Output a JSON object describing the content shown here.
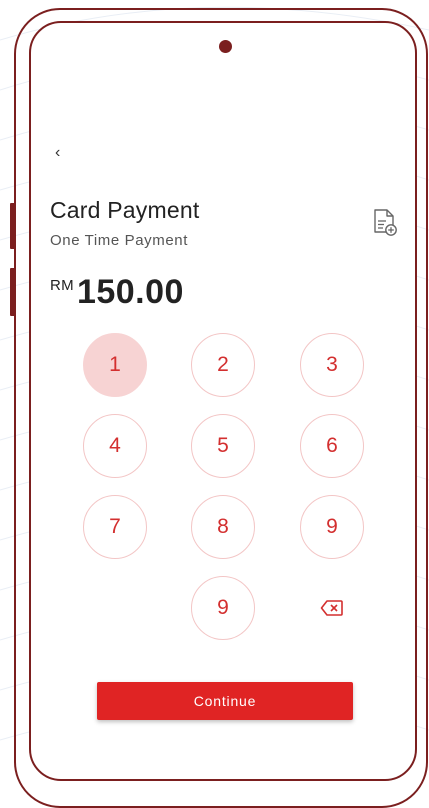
{
  "nav": {
    "back_symbol": "‹"
  },
  "header": {
    "title": "Card Payment",
    "subtitle": "One Time Payment",
    "action_icon": "receipt-add-icon"
  },
  "amount": {
    "currency": "RM",
    "value": "150.00"
  },
  "keypad": {
    "keys": [
      "1",
      "2",
      "3",
      "4",
      "5",
      "6",
      "7",
      "8",
      "9",
      "9"
    ],
    "active_key": "1",
    "delete_icon": "backspace-icon"
  },
  "footer": {
    "continue_label": "Continue"
  },
  "colors": {
    "frame": "#7b1f1f",
    "accent": "#e02424",
    "key_text": "#d32f2f",
    "key_border": "#f3c6c6",
    "key_active_bg": "#f7d3d3"
  }
}
